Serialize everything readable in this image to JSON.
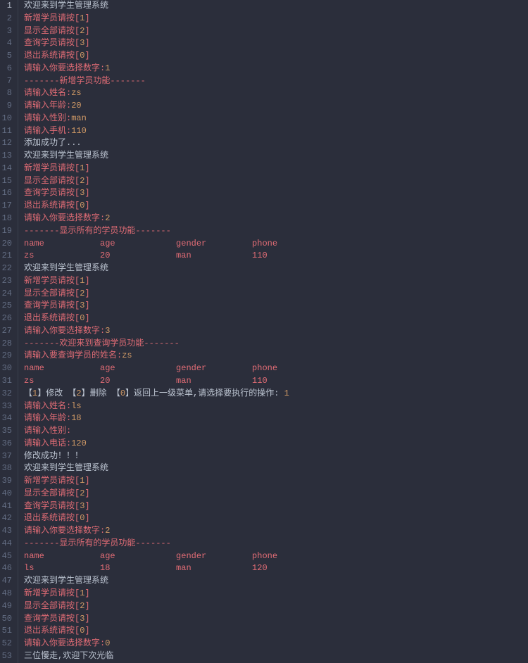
{
  "lines": [
    {
      "n": 1,
      "segs": [
        {
          "t": "欢迎来到学生管理系统",
          "c": "c-white"
        }
      ]
    },
    {
      "n": 2,
      "segs": [
        {
          "t": "新增学员请按[",
          "c": "c-red"
        },
        {
          "t": "1",
          "c": "c-orange"
        },
        {
          "t": "]",
          "c": "c-red"
        }
      ]
    },
    {
      "n": 3,
      "segs": [
        {
          "t": "显示全部请按[",
          "c": "c-red"
        },
        {
          "t": "2",
          "c": "c-orange"
        },
        {
          "t": "]",
          "c": "c-red"
        }
      ]
    },
    {
      "n": 4,
      "segs": [
        {
          "t": "查询学员请按[",
          "c": "c-red"
        },
        {
          "t": "3",
          "c": "c-orange"
        },
        {
          "t": "]",
          "c": "c-red"
        }
      ]
    },
    {
      "n": 5,
      "segs": [
        {
          "t": "退出系统请按[",
          "c": "c-red"
        },
        {
          "t": "0",
          "c": "c-orange"
        },
        {
          "t": "]",
          "c": "c-red"
        }
      ]
    },
    {
      "n": 6,
      "segs": [
        {
          "t": "请输入你要选择数字:",
          "c": "c-red"
        },
        {
          "t": "1",
          "c": "c-orange"
        }
      ]
    },
    {
      "n": 7,
      "segs": [
        {
          "t": "-------新增学员功能-------",
          "c": "c-red"
        }
      ]
    },
    {
      "n": 8,
      "segs": [
        {
          "t": "请输入姓名:",
          "c": "c-red"
        },
        {
          "t": "zs",
          "c": "c-orange"
        }
      ]
    },
    {
      "n": 9,
      "segs": [
        {
          "t": "请输入年龄:",
          "c": "c-red"
        },
        {
          "t": "20",
          "c": "c-orange"
        }
      ]
    },
    {
      "n": 10,
      "segs": [
        {
          "t": "请输入性别:",
          "c": "c-red"
        },
        {
          "t": "man",
          "c": "c-orange"
        }
      ]
    },
    {
      "n": 11,
      "segs": [
        {
          "t": "请输入手机:",
          "c": "c-red"
        },
        {
          "t": "110",
          "c": "c-orange"
        }
      ]
    },
    {
      "n": 12,
      "segs": [
        {
          "t": "添加成功了...",
          "c": "c-white"
        }
      ]
    },
    {
      "n": 13,
      "segs": [
        {
          "t": "欢迎来到学生管理系统",
          "c": "c-white"
        }
      ]
    },
    {
      "n": 14,
      "segs": [
        {
          "t": "新增学员请按[",
          "c": "c-red"
        },
        {
          "t": "1",
          "c": "c-orange"
        },
        {
          "t": "]",
          "c": "c-red"
        }
      ]
    },
    {
      "n": 15,
      "segs": [
        {
          "t": "显示全部请按[",
          "c": "c-red"
        },
        {
          "t": "2",
          "c": "c-orange"
        },
        {
          "t": "]",
          "c": "c-red"
        }
      ]
    },
    {
      "n": 16,
      "segs": [
        {
          "t": "查询学员请按[",
          "c": "c-red"
        },
        {
          "t": "3",
          "c": "c-orange"
        },
        {
          "t": "]",
          "c": "c-red"
        }
      ]
    },
    {
      "n": 17,
      "segs": [
        {
          "t": "退出系统请按[",
          "c": "c-red"
        },
        {
          "t": "0",
          "c": "c-orange"
        },
        {
          "t": "]",
          "c": "c-red"
        }
      ]
    },
    {
      "n": 18,
      "segs": [
        {
          "t": "请输入你要选择数字:",
          "c": "c-red"
        },
        {
          "t": "2",
          "c": "c-orange"
        }
      ]
    },
    {
      "n": 19,
      "segs": [
        {
          "t": "-------显示所有的学员功能-------",
          "c": "c-red"
        }
      ]
    },
    {
      "n": 20,
      "segs": [
        {
          "t": "name           age            gender         phone",
          "c": "c-red"
        }
      ]
    },
    {
      "n": 21,
      "segs": [
        {
          "t": "zs             20             man            110",
          "c": "c-red"
        }
      ]
    },
    {
      "n": 22,
      "segs": [
        {
          "t": "欢迎来到学生管理系统",
          "c": "c-white"
        }
      ]
    },
    {
      "n": 23,
      "segs": [
        {
          "t": "新增学员请按[",
          "c": "c-red"
        },
        {
          "t": "1",
          "c": "c-orange"
        },
        {
          "t": "]",
          "c": "c-red"
        }
      ]
    },
    {
      "n": 24,
      "segs": [
        {
          "t": "显示全部请按[",
          "c": "c-red"
        },
        {
          "t": "2",
          "c": "c-orange"
        },
        {
          "t": "]",
          "c": "c-red"
        }
      ]
    },
    {
      "n": 25,
      "segs": [
        {
          "t": "查询学员请按[",
          "c": "c-red"
        },
        {
          "t": "3",
          "c": "c-orange"
        },
        {
          "t": "]",
          "c": "c-red"
        }
      ]
    },
    {
      "n": 26,
      "segs": [
        {
          "t": "退出系统请按[",
          "c": "c-red"
        },
        {
          "t": "0",
          "c": "c-orange"
        },
        {
          "t": "]",
          "c": "c-red"
        }
      ]
    },
    {
      "n": 27,
      "segs": [
        {
          "t": "请输入你要选择数字:",
          "c": "c-red"
        },
        {
          "t": "3",
          "c": "c-orange"
        }
      ]
    },
    {
      "n": 28,
      "segs": [
        {
          "t": "-------欢迎来到查询学员功能-------",
          "c": "c-red"
        }
      ]
    },
    {
      "n": 29,
      "segs": [
        {
          "t": "请输入要查询学员的姓名:",
          "c": "c-red"
        },
        {
          "t": "zs",
          "c": "c-orange"
        }
      ]
    },
    {
      "n": 30,
      "segs": [
        {
          "t": "name           age            gender         phone",
          "c": "c-red"
        }
      ]
    },
    {
      "n": 31,
      "segs": [
        {
          "t": "zs             20             man            110",
          "c": "c-red"
        }
      ]
    },
    {
      "n": 32,
      "segs": [
        {
          "t": "【",
          "c": "c-white"
        },
        {
          "t": "1",
          "c": "c-orange"
        },
        {
          "t": "】修改 【",
          "c": "c-white"
        },
        {
          "t": "2",
          "c": "c-orange"
        },
        {
          "t": "】删除 【",
          "c": "c-white"
        },
        {
          "t": "0",
          "c": "c-orange"
        },
        {
          "t": "】返回上一级菜单,请选择要执行的操作: ",
          "c": "c-white"
        },
        {
          "t": "1",
          "c": "c-orange"
        }
      ]
    },
    {
      "n": 33,
      "segs": [
        {
          "t": "请输入姓名:",
          "c": "c-red"
        },
        {
          "t": "ls",
          "c": "c-orange"
        }
      ]
    },
    {
      "n": 34,
      "segs": [
        {
          "t": "请输入年龄:",
          "c": "c-red"
        },
        {
          "t": "18",
          "c": "c-orange"
        }
      ]
    },
    {
      "n": 35,
      "segs": [
        {
          "t": "请输入性别:",
          "c": "c-red"
        }
      ]
    },
    {
      "n": 36,
      "segs": [
        {
          "t": "请输入电话:",
          "c": "c-red"
        },
        {
          "t": "120",
          "c": "c-orange"
        }
      ]
    },
    {
      "n": 37,
      "segs": [
        {
          "t": "修改成功！！！",
          "c": "c-white"
        }
      ]
    },
    {
      "n": 38,
      "segs": [
        {
          "t": "欢迎来到学生管理系统",
          "c": "c-white"
        }
      ]
    },
    {
      "n": 39,
      "segs": [
        {
          "t": "新增学员请按[",
          "c": "c-red"
        },
        {
          "t": "1",
          "c": "c-orange"
        },
        {
          "t": "]",
          "c": "c-red"
        }
      ]
    },
    {
      "n": 40,
      "segs": [
        {
          "t": "显示全部请按[",
          "c": "c-red"
        },
        {
          "t": "2",
          "c": "c-orange"
        },
        {
          "t": "]",
          "c": "c-red"
        }
      ]
    },
    {
      "n": 41,
      "segs": [
        {
          "t": "查询学员请按[",
          "c": "c-red"
        },
        {
          "t": "3",
          "c": "c-orange"
        },
        {
          "t": "]",
          "c": "c-red"
        }
      ]
    },
    {
      "n": 42,
      "segs": [
        {
          "t": "退出系统请按[",
          "c": "c-red"
        },
        {
          "t": "0",
          "c": "c-orange"
        },
        {
          "t": "]",
          "c": "c-red"
        }
      ]
    },
    {
      "n": 43,
      "segs": [
        {
          "t": "请输入你要选择数字:",
          "c": "c-red"
        },
        {
          "t": "2",
          "c": "c-orange"
        }
      ]
    },
    {
      "n": 44,
      "segs": [
        {
          "t": "-------显示所有的学员功能-------",
          "c": "c-red"
        }
      ]
    },
    {
      "n": 45,
      "segs": [
        {
          "t": "name           age            gender         phone",
          "c": "c-red"
        }
      ]
    },
    {
      "n": 46,
      "segs": [
        {
          "t": "ls             18             man            120",
          "c": "c-red"
        }
      ]
    },
    {
      "n": 47,
      "segs": [
        {
          "t": "欢迎来到学生管理系统",
          "c": "c-white"
        }
      ]
    },
    {
      "n": 48,
      "segs": [
        {
          "t": "新增学员请按[",
          "c": "c-red"
        },
        {
          "t": "1",
          "c": "c-orange"
        },
        {
          "t": "]",
          "c": "c-red"
        }
      ]
    },
    {
      "n": 49,
      "segs": [
        {
          "t": "显示全部请按[",
          "c": "c-red"
        },
        {
          "t": "2",
          "c": "c-orange"
        },
        {
          "t": "]",
          "c": "c-red"
        }
      ]
    },
    {
      "n": 50,
      "segs": [
        {
          "t": "查询学员请按[",
          "c": "c-red"
        },
        {
          "t": "3",
          "c": "c-orange"
        },
        {
          "t": "]",
          "c": "c-red"
        }
      ]
    },
    {
      "n": 51,
      "segs": [
        {
          "t": "退出系统请按[",
          "c": "c-red"
        },
        {
          "t": "0",
          "c": "c-orange"
        },
        {
          "t": "]",
          "c": "c-red"
        }
      ]
    },
    {
      "n": 52,
      "segs": [
        {
          "t": "请输入你要选择数字:",
          "c": "c-red"
        },
        {
          "t": "0",
          "c": "c-orange"
        }
      ]
    },
    {
      "n": 53,
      "segs": [
        {
          "t": "三位慢走,欢迎下次光临",
          "c": "c-white"
        }
      ]
    }
  ]
}
